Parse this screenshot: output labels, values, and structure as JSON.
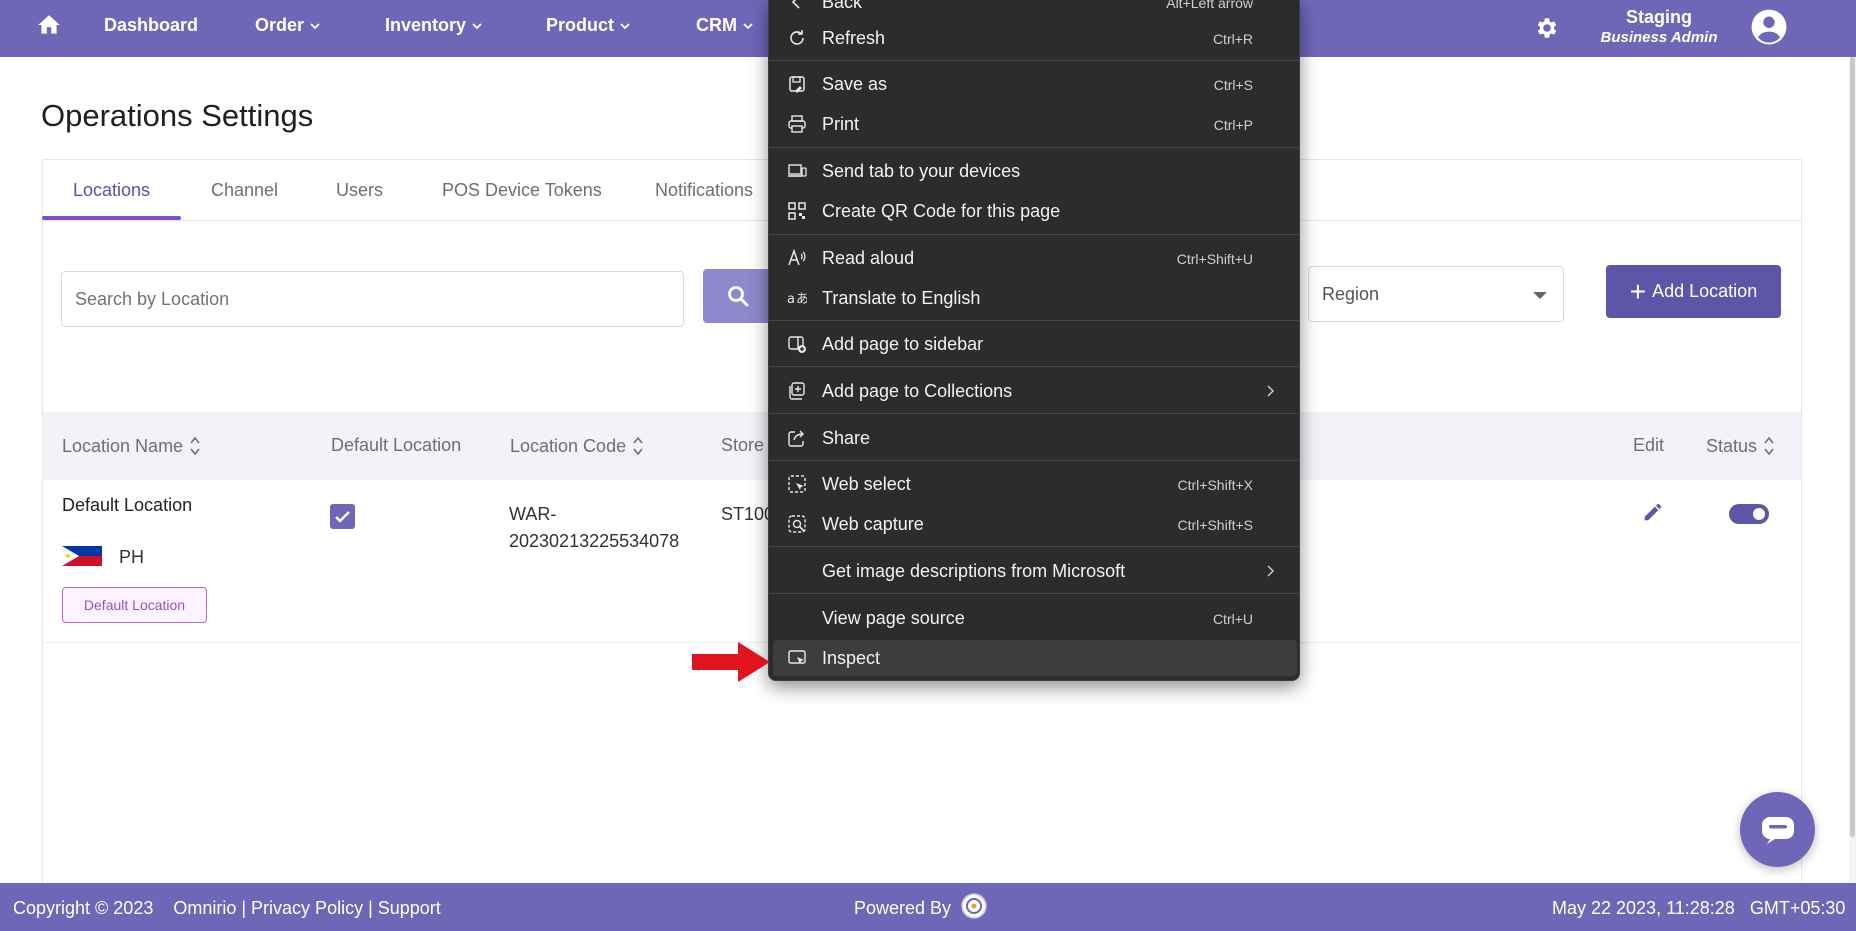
{
  "nav": {
    "items": [
      {
        "label": "Dashboard",
        "dropdown": false
      },
      {
        "label": "Order",
        "dropdown": true
      },
      {
        "label": "Inventory",
        "dropdown": true
      },
      {
        "label": "Product",
        "dropdown": true
      },
      {
        "label": "CRM",
        "dropdown": true
      }
    ],
    "env_name": "Staging",
    "env_role": "Business Admin"
  },
  "page": {
    "title": "Operations Settings",
    "tabs": [
      "Locations",
      "Channel",
      "Users",
      "POS Device Tokens",
      "Notifications"
    ],
    "active_tab": "Locations"
  },
  "filters": {
    "search_placeholder": "Search by Location",
    "region_label": "Region",
    "add_button": "Add Location"
  },
  "table": {
    "headers": {
      "name": "Location Name",
      "default": "Default Location",
      "code": "Location Code",
      "store": "Store",
      "edit": "Edit",
      "status": "Status"
    },
    "rows": [
      {
        "name": "Default Location",
        "country": "PH",
        "badge": "Default Location",
        "default_checked": true,
        "code_line1": "WAR-",
        "code_line2": "20230213225534078",
        "store": "ST100",
        "status_on": true
      }
    ]
  },
  "context_menu": {
    "items": [
      {
        "label": "Back",
        "shortcut": "Alt+Left arrow",
        "icon": "back-arrow-icon"
      },
      {
        "label": "Refresh",
        "shortcut": "Ctrl+R",
        "icon": "refresh-icon"
      },
      {
        "label": "Save as",
        "shortcut": "Ctrl+S",
        "icon": "save-icon"
      },
      {
        "label": "Print",
        "shortcut": "Ctrl+P",
        "icon": "print-icon"
      },
      {
        "label": "Send tab to your devices",
        "shortcut": "",
        "icon": "devices-icon"
      },
      {
        "label": "Create QR Code for this page",
        "shortcut": "",
        "icon": "qr-code-icon"
      },
      {
        "label": "Read aloud",
        "shortcut": "Ctrl+Shift+U",
        "icon": "read-aloud-icon"
      },
      {
        "label": "Translate to English",
        "shortcut": "",
        "icon": "translate-icon"
      },
      {
        "label": "Add page to sidebar",
        "shortcut": "",
        "icon": "sidebar-add-icon"
      },
      {
        "label": "Add page to Collections",
        "shortcut": "",
        "icon": "collections-icon",
        "submenu": true
      },
      {
        "label": "Share",
        "shortcut": "",
        "icon": "share-icon"
      },
      {
        "label": "Web select",
        "shortcut": "Ctrl+Shift+X",
        "icon": "web-select-icon"
      },
      {
        "label": "Web capture",
        "shortcut": "Ctrl+Shift+S",
        "icon": "web-capture-icon"
      },
      {
        "label": "Get image descriptions from Microsoft",
        "shortcut": "",
        "icon": "",
        "submenu": true
      },
      {
        "label": "View page source",
        "shortcut": "Ctrl+U",
        "icon": ""
      },
      {
        "label": "Inspect",
        "shortcut": "",
        "icon": "inspect-icon"
      }
    ]
  },
  "footer": {
    "copyright": "Copyright © 2023",
    "links": "Omnirio | Privacy Policy | Support",
    "powered_by": "Powered By",
    "timestamp": "May 22 2023, 11:28:28",
    "timezone": "GMT+05:30"
  },
  "colors": {
    "brand": "#6f66b8",
    "accent": "#5c55a8",
    "tab_active": "#7e4dd0",
    "menu_bg": "#2c2c2c",
    "arrow": "#e0141e"
  }
}
